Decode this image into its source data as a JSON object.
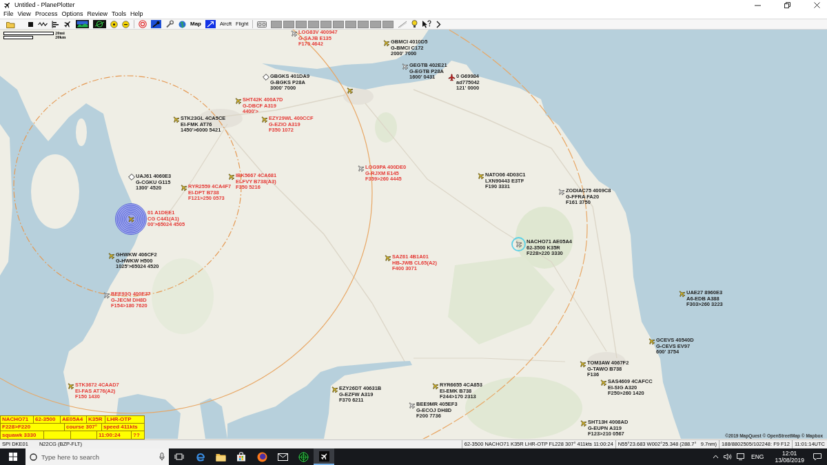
{
  "window": {
    "title": "Untitled - PlanePlotter"
  },
  "menu": [
    "File",
    "View",
    "Process",
    "Options",
    "Review",
    "Tools",
    "Help"
  ],
  "toolbar": {
    "map": "Map",
    "aircraft": "Aircft",
    "flight": "Flight"
  },
  "map": {
    "scale": {
      "miles": "20mi",
      "kilometres": "20km"
    },
    "aircraft": [
      {
        "kind": "outline",
        "selected": false,
        "color": "#e53935",
        "lines": [
          "LOG83V 400947",
          "G-SAJB E135",
          "F170 4642"
        ]
      },
      {
        "kind": "plane",
        "selected": false,
        "color": "#222222",
        "lines": [
          "GBMCI 4010D5",
          "G-BMCI C172",
          "2000' 7000"
        ]
      },
      {
        "kind": "outline",
        "selected": false,
        "color": "#222222",
        "lines": [
          "GEGTB 402E21",
          "G-EGTB P28A",
          "1600' 0431"
        ]
      },
      {
        "kind": "diamond",
        "selected": false,
        "color": "#222222",
        "lines": [
          "GBGKS 401DA9",
          "G-BGKS P28A",
          "3000' 7000"
        ]
      },
      {
        "kind": "alert",
        "selected": false,
        "color": "#222222",
        "lines": [
          "0 G69984",
          "ad775042",
          "121' 0000"
        ]
      },
      {
        "kind": "plane",
        "selected": false,
        "color": "#e53935",
        "lines": [
          "SHT42K 400A7D",
          "G-DBCF A319",
          "4400'>"
        ]
      },
      {
        "kind": "plane",
        "selected": false,
        "color": "#222222",
        "lines": [
          "STK23GL 4CA5CE",
          "EI-FMK AT76",
          "1450'>6000 5421"
        ]
      },
      {
        "kind": "plane",
        "selected": false,
        "color": "#e53935",
        "lines": [
          "EZY29WL 400CCF",
          "G-EZIO A319",
          "F350 1072"
        ]
      },
      {
        "kind": "outline",
        "selected": false,
        "color": "#e53935",
        "lines": [
          "LOG9PA 400DE0",
          "G-RJXM E145",
          "F359>260 4445"
        ]
      },
      {
        "kind": "diamond",
        "selected": false,
        "color": "#222222",
        "lines": [
          "UAJ61 4060E3",
          "G-CGKU G115",
          "1300' 4520"
        ]
      },
      {
        "kind": "plane",
        "selected": false,
        "color": "#e53935",
        "lines": [
          "IBK5667 4CA681",
          "EI-FVY B738(A3)",
          "F350 5216"
        ]
      },
      {
        "kind": "plane",
        "selected": false,
        "color": "#222222",
        "lines": [
          "NATO06 4D03C1",
          "LXN90443 E3TF",
          "F190 3331"
        ]
      },
      {
        "kind": "plane",
        "selected": false,
        "color": "#e53935",
        "lines": [
          "RYR2559 4CA4F7",
          "EI-DPT B738",
          "F121>250 0573"
        ]
      },
      {
        "kind": "outline",
        "selected": false,
        "color": "#222222",
        "lines": [
          "ZODIAC75 4009C8",
          "G-FFRA FA20",
          "F161 3750"
        ]
      },
      {
        "kind": "spi",
        "selected": false,
        "color": "#e53935",
        "lines": [
          "01 A1DEE1",
          "CG C441(A1)",
          "00'>65024 4505"
        ]
      },
      {
        "kind": "outline",
        "selected": true,
        "color": "#222222",
        "lines": [
          "NACHO71 AE05A4",
          "62-3500 K35R",
          "F228>220 3330"
        ]
      },
      {
        "kind": "plane",
        "selected": false,
        "color": "#222222",
        "lines": [
          "GHWKW 406CF2",
          "G-HWKW H500",
          "1025'>65024 4520"
        ]
      },
      {
        "kind": "plane",
        "selected": false,
        "color": "#e53935",
        "lines": [
          "SAZ61 4B1A01",
          "HB-JWB CL65(A2)",
          "F400 3071"
        ]
      },
      {
        "kind": "outline",
        "selected": false,
        "color": "#e53935",
        "lines": [
          "BEE93G 400E37",
          "G-JECM DH8D",
          "F154>180 7620"
        ]
      },
      {
        "kind": "plane",
        "selected": false,
        "color": "#222222",
        "lines": [
          "UAE27 8960E3",
          "A6-EDB A388",
          "F303>260 3223"
        ]
      },
      {
        "kind": "plane",
        "selected": false,
        "color": "#222222",
        "lines": [
          "GCEVS 40540D",
          "G-CEVS EV97",
          "600' 3754"
        ]
      },
      {
        "kind": "plane",
        "selected": false,
        "color": "#222222",
        "lines": [
          "TOM3AW 4067F2",
          "G-TAWO B738",
          "F136"
        ]
      },
      {
        "kind": "plane",
        "selected": false,
        "color": "#e53935",
        "lines": [
          "STK3672 4CAAD7",
          "EI-FAS AT76(A2)",
          "F150 1430"
        ]
      },
      {
        "kind": "plane",
        "selected": false,
        "color": "#222222",
        "lines": [
          "EZY26DT 40631B",
          "G-EZFW A319",
          "F370 6211"
        ]
      },
      {
        "kind": "plane",
        "selected": false,
        "color": "#222222",
        "lines": [
          "RYR6655 4CA853",
          "EI-EMK B738",
          "F244>170 2313"
        ]
      },
      {
        "kind": "plane",
        "selected": false,
        "color": "#222222",
        "lines": [
          "SAS4609 4CAFCC",
          "EI-SIG A320",
          "F250>260 1420"
        ]
      },
      {
        "kind": "outline",
        "selected": false,
        "color": "#222222",
        "lines": [
          "BEE9MR 405EF3",
          "G-ECOJ DH8D",
          "F200 7736"
        ]
      },
      {
        "kind": "plane",
        "selected": false,
        "color": "#222222",
        "lines": [
          "SHT13H 4008AD",
          "G-EUPN A319",
          "F123>210 0567"
        ]
      }
    ],
    "attribution": "©2019 MapQuest © OpenStreetMap © Mapbox"
  },
  "info_panel": {
    "lines": [
      {
        "fields": [
          "NACHO71",
          "62-3500",
          "AE05A4",
          "K35R",
          "LHR-OTP"
        ]
      },
      {
        "fields": [
          "F228>F220",
          "course 307°",
          "speed 411kts"
        ]
      },
      {
        "fields": [
          "squawk 3330",
          "11:00:24",
          "??"
        ]
      }
    ]
  },
  "status_bar": {
    "left": [
      "SPI DKE01",
      "N22CG (BZP-FLT)"
    ],
    "right": [
      "62-3500 NACHO71 K35R LHR-OTP FL228 307° 411kts 11:00:24",
      "N55°23.683 W002°25.348 (288.7°   9.7nm)",
      "188/8802505/102248: F9 F12",
      "11:01:14UTC"
    ]
  },
  "taskbar": {
    "search": {
      "placeholder": "Type here to search"
    },
    "apps": [
      {
        "selected": false
      },
      {
        "selected": false
      },
      {
        "selected": false
      },
      {
        "selected": false
      },
      {
        "selected": false
      },
      {
        "selected": false
      },
      {
        "selected": true
      }
    ],
    "language": "ENG",
    "time": "12:01",
    "date": "13/08/2019"
  }
}
